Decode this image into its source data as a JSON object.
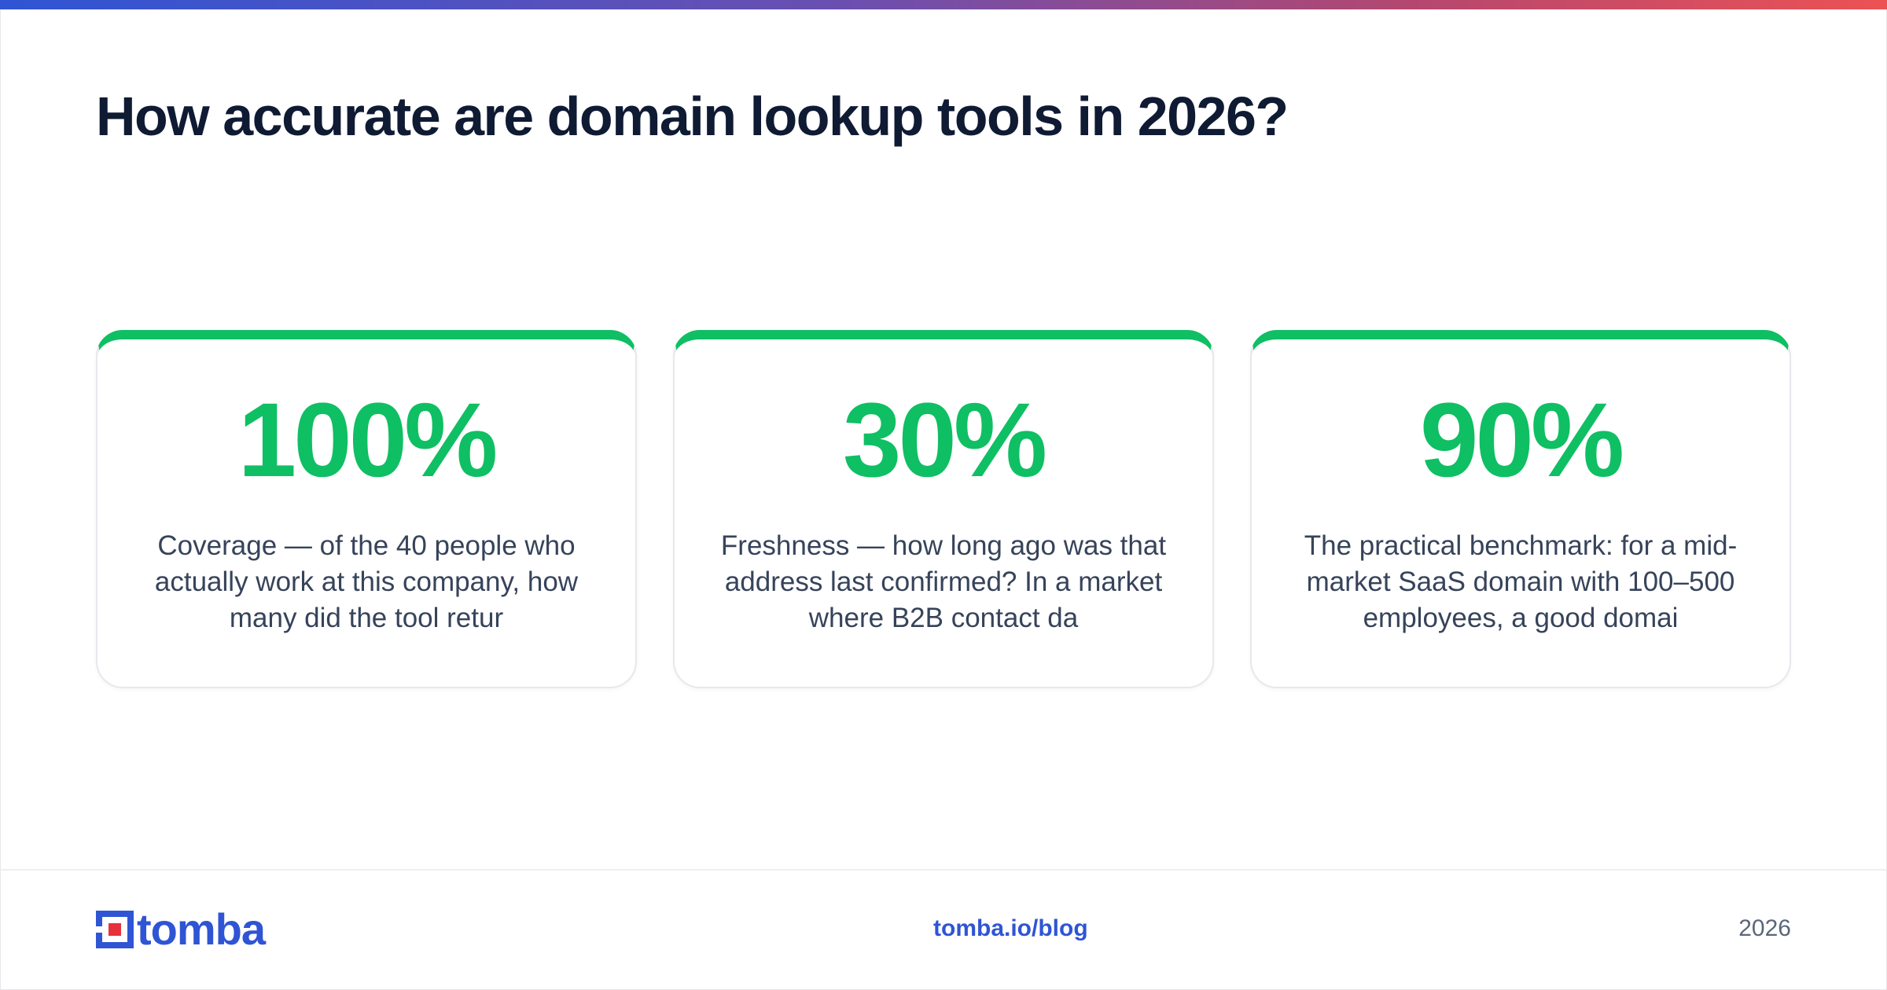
{
  "header": {
    "title": "How accurate are domain lookup tools in 2026?"
  },
  "stats": [
    {
      "value": "100%",
      "description": "Coverage — of the 40 people who actually work at this company, how many did the tool retur"
    },
    {
      "value": "30%",
      "description": "Freshness — how long ago was that address last confirmed? In a market where B2B contact da"
    },
    {
      "value": "90%",
      "description": "The practical benchmark: for a mid-market SaaS domain with 100–500 employees, a good domai"
    }
  ],
  "footer": {
    "brand": "tomba",
    "link": "tomba.io/blog",
    "year": "2026"
  },
  "colors": {
    "accent_green": "#0fbf63",
    "brand_blue": "#2f55d4",
    "brand_red": "#e6323b",
    "title": "#0f1a33",
    "body_text": "#36435a"
  },
  "icons": {
    "logo": "tomba-logo-icon"
  }
}
